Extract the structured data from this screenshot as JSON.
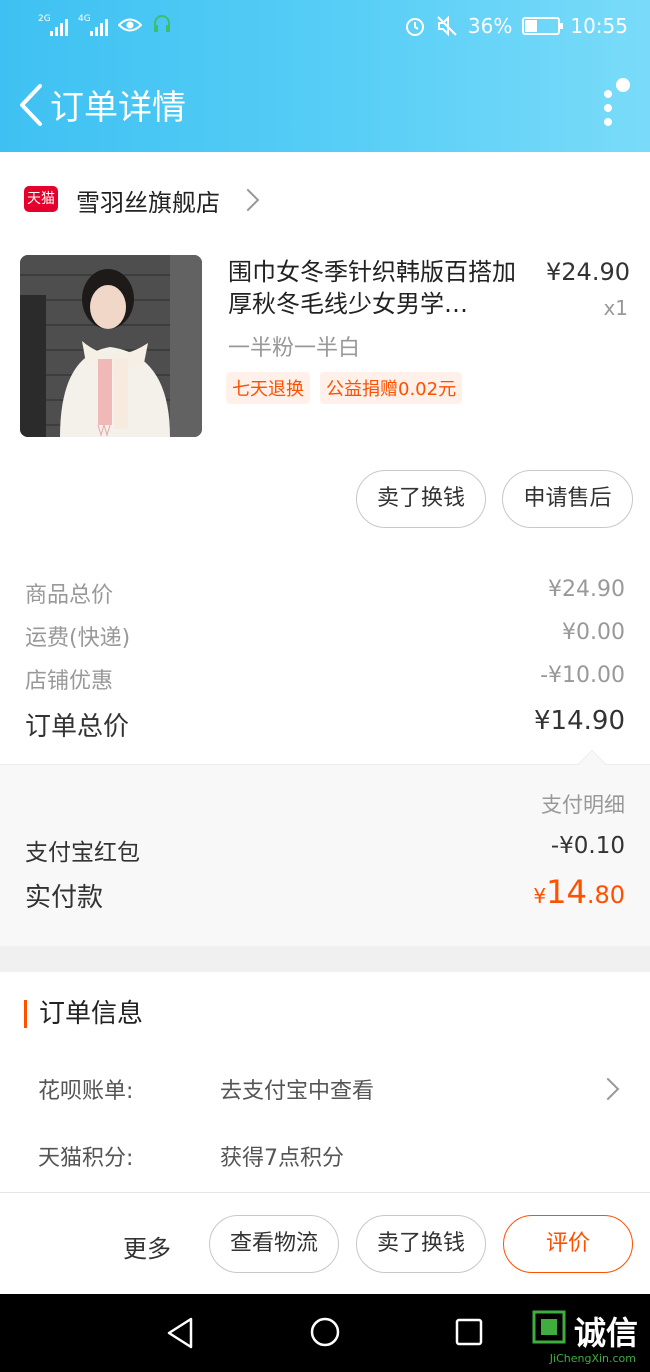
{
  "status_bar": {
    "net1": "2G",
    "net2": "4G",
    "battery": "36%",
    "battery_level": 0.36,
    "time": "10:55"
  },
  "header": {
    "title": "订单详情",
    "back_icon": "chevron-left-icon",
    "more_icon": "more-vertical-icon",
    "accent": "#3ec1f2"
  },
  "store": {
    "badge": "天猫",
    "name": "雪羽丝旗舰店"
  },
  "product": {
    "title": "围巾女冬季针织韩版百搭加厚秋冬毛线少女男学…",
    "price": "¥24.90",
    "qty": "x1",
    "sku": "一半粉一半白",
    "tags": [
      "七天退换",
      "公益捐赠0.02元"
    ]
  },
  "product_actions": {
    "sell": "卖了换钱",
    "after_sale": "申请售后"
  },
  "summary": {
    "goods_label": "商品总价",
    "goods_value": "¥24.90",
    "shipping_label": "运费(快递)",
    "shipping_value": "¥0.00",
    "discount_label": "店铺优惠",
    "discount_value": "-¥10.00",
    "total_label": "订单总价",
    "total_value": "¥14.90"
  },
  "payment": {
    "detail_link": "支付明细",
    "redpacket_label": "支付宝红包",
    "redpacket_value": "-¥0.10",
    "paid_label": "实付款",
    "paid_symbol": "¥",
    "paid_int": "14",
    "paid_dec": ".80",
    "paid_color": "#ff5000"
  },
  "order_info": {
    "title": "订单信息",
    "huabei_label": "花呗账单:",
    "huabei_value": "去支付宝中查看",
    "points_label": "天猫积分:",
    "points_value": "获得7点积分"
  },
  "action_bar": {
    "more": "更多",
    "logistics": "查看物流",
    "sell": "卖了换钱",
    "review": "评价"
  },
  "watermark": {
    "text": "诚信",
    "site": "JiChengXin.com"
  }
}
